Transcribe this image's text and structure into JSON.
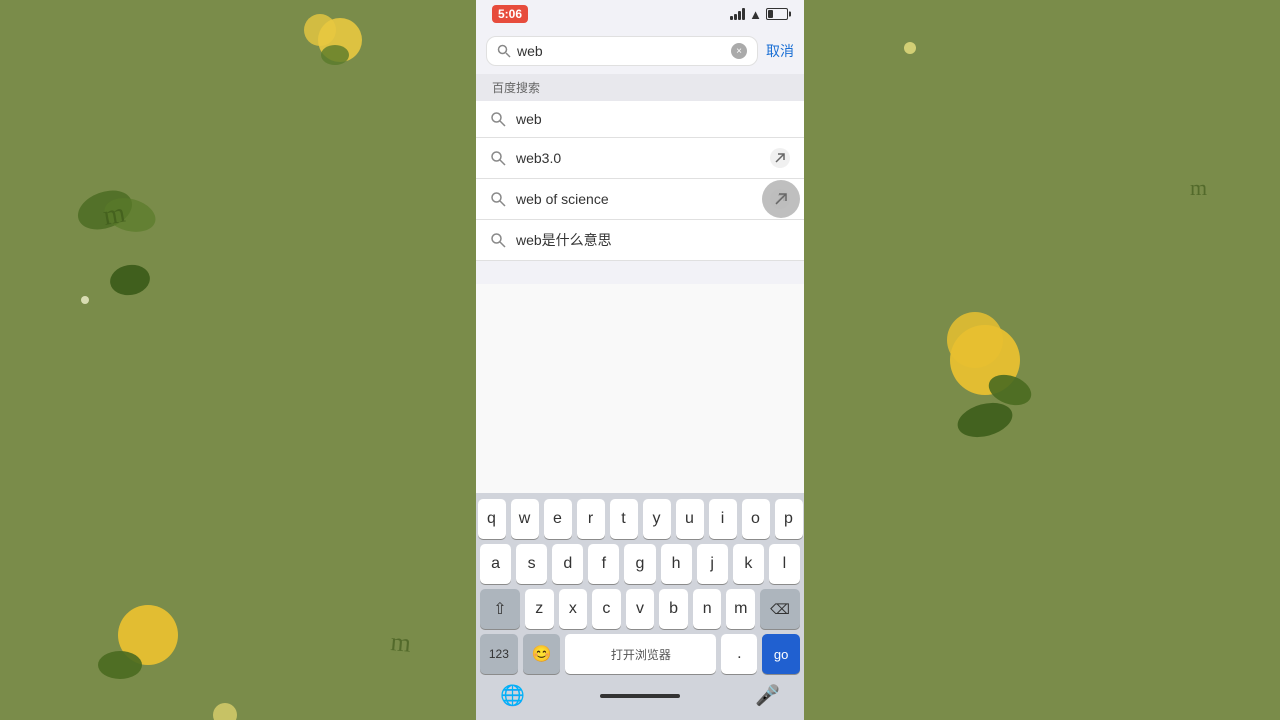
{
  "background": {
    "color": "#7a8c4a"
  },
  "status_bar": {
    "time": "5:06",
    "cancel_label": "取消"
  },
  "search": {
    "input_value": "web",
    "placeholder": "web",
    "clear_title": "×",
    "section_header": "百度搜索"
  },
  "suggestions": [
    {
      "text": "web",
      "has_arrow": false
    },
    {
      "text": "web3.0",
      "has_arrow": true
    },
    {
      "text": "web of science",
      "has_arrow": true
    },
    {
      "text": "web是什么意思",
      "has_arrow": false
    }
  ],
  "open_browser_label": "打开浏览器",
  "keyboard": {
    "rows": [
      [
        "q",
        "w",
        "e",
        "r",
        "t",
        "y",
        "u",
        "i",
        "o",
        "p"
      ],
      [
        "a",
        "s",
        "d",
        "f",
        "g",
        "h",
        "j",
        "k",
        "l"
      ],
      [
        "z",
        "x",
        "c",
        "v",
        "b",
        "n",
        "m"
      ],
      [
        "123",
        "😊",
        "打开浏览器",
        ".",
        "go"
      ]
    ],
    "shift_label": "⇧",
    "delete_label": "⌫",
    "globe_label": "🌐",
    "mic_label": "🎤"
  }
}
